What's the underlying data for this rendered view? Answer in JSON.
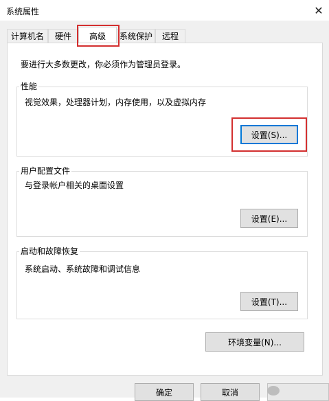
{
  "window": {
    "title": "系统属性"
  },
  "tabs": [
    {
      "label": "计算机名",
      "active": false
    },
    {
      "label": "硬件",
      "active": false
    },
    {
      "label": "高级",
      "active": true
    },
    {
      "label": "系统保护",
      "active": false
    },
    {
      "label": "远程",
      "active": false
    }
  ],
  "notice": "要进行大多数更改，你必须作为管理员登录。",
  "groups": {
    "performance": {
      "legend": "性能",
      "description": "视觉效果，处理器计划，内存使用，以及虚拟内存",
      "button": "设置(S)..."
    },
    "user_profiles": {
      "legend": "用户配置文件",
      "description": "与登录帐户相关的桌面设置",
      "button": "设置(E)..."
    },
    "startup_recovery": {
      "legend": "启动和故障恢复",
      "description": "系统启动、系统故障和调试信息",
      "button": "设置(T)..."
    }
  },
  "env_button": "环境变量(N)...",
  "footer": {
    "ok": "确定",
    "cancel": "取消"
  },
  "icons": {
    "close": "close-icon"
  },
  "colors": {
    "highlight_red": "#d32f2f",
    "focus_blue": "#0078d7"
  }
}
